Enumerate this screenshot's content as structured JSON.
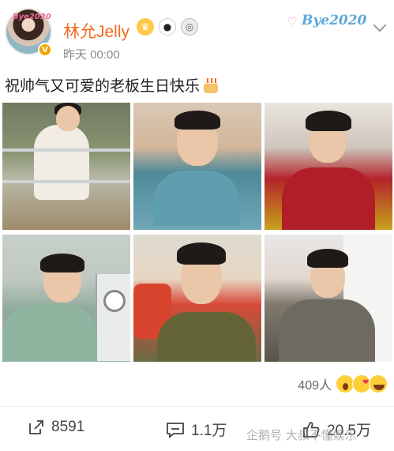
{
  "post": {
    "author": {
      "name": "林允Jelly",
      "avatar_sticker_text": "Bye2020",
      "verified_badge": "V",
      "badges": [
        "crown-badge-icon",
        "panda-badge-icon",
        "medal-badge-icon"
      ]
    },
    "time": "昨天 00:00",
    "header_sticker_text": "Bye2020",
    "text": "祝帅气又可爱的老板生日快乐",
    "text_emoji": "birthday-cake-icon",
    "photos": [
      {
        "name": "photo-1"
      },
      {
        "name": "photo-2"
      },
      {
        "name": "photo-3"
      },
      {
        "name": "photo-4"
      },
      {
        "name": "photo-5"
      },
      {
        "name": "photo-6"
      }
    ],
    "reactions": {
      "count": "409人",
      "emojis": [
        "wow-emoji",
        "kiss-emoji",
        "laugh-emoji"
      ]
    }
  },
  "actions": {
    "share": "8591",
    "comment": "1.1万",
    "like": "20.5万"
  },
  "watermark": "企鹅号 大叔不懂娱乐",
  "colors": {
    "name": "#f26b1d",
    "sticker": "#5fa8d8",
    "muted": "#8a8a8a"
  }
}
